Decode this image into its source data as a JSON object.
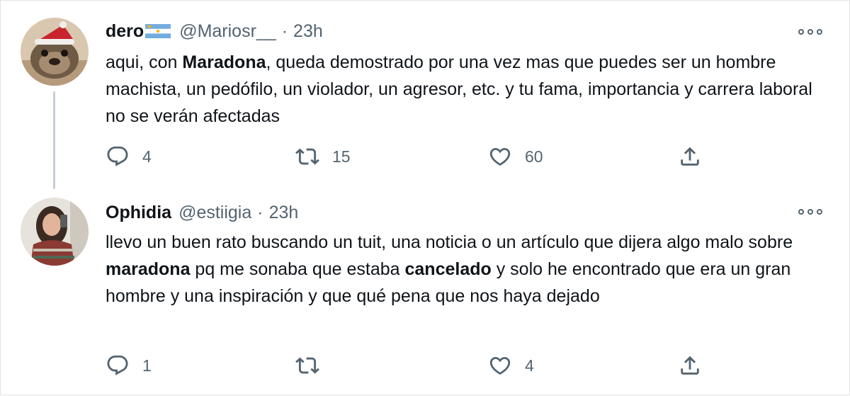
{
  "tweets": [
    {
      "name": "dero",
      "handle": "@Mariosr__",
      "separator": "·",
      "time": "23h",
      "body": {
        "p1": "aqui, con ",
        "b1": "Maradona",
        "p2": ", queda demostrado por una vez mas que puedes ser un hombre machista, un pedófilo, un violador, un agresor, etc. y tu fama, importancia y carrera laboral no se verán afectadas"
      },
      "replies": "4",
      "retweets": "15",
      "likes": "60"
    },
    {
      "name": "Ophidia",
      "handle": "@estiigia",
      "separator": "·",
      "time": "23h",
      "body": {
        "p1": "llevo un buen rato buscando un tuit, una noticia o un artículo que dijera algo malo sobre ",
        "b1": "maradona",
        "p2": " pq me sonaba que estaba ",
        "b2": "cancelado",
        "p3": " y solo he encontrado que era un gran hombre y una inspiración y que qué pena que nos haya dejado"
      },
      "replies": "1",
      "retweets": "",
      "likes": "4"
    }
  ],
  "icons": {
    "reply": "reply-icon",
    "retweet": "retweet-icon",
    "like": "heart-icon",
    "share": "share-icon",
    "more": "more-icon",
    "flag": "argentina-flag-icon"
  },
  "colors": {
    "text": "#0f1419",
    "secondary": "#536471",
    "thread_line": "#c4cfd6",
    "border": "#e3e3e3"
  }
}
